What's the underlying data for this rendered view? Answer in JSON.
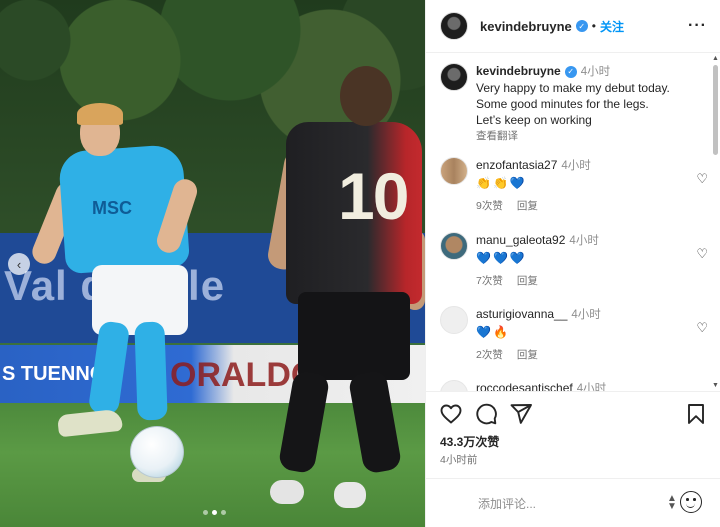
{
  "post": {
    "author": "kevindebruyne",
    "separator": "•",
    "follow_label": "关注",
    "more_label": "···",
    "caption_time": "4小时",
    "caption_text": "Very happy to make my debut today.\nSome good minutes for the legs.\nLet’s keep on working",
    "see_translation": "查看翻译",
    "likes": "43.3万次赞",
    "posted": "4小时前",
    "comment_placeholder": "添加评论..."
  },
  "photo": {
    "banner_text": "Val di Sole",
    "ad_left": "S TUENNO",
    "ad_right": "ORALDO",
    "jersey_sponsor": "MSC",
    "jersey_number": "10",
    "carousel_prev": "‹"
  },
  "comments": [
    {
      "user": "enzofantasia27",
      "time": "4小时",
      "emoji": "👏👏💙",
      "likes": "9次赞",
      "reply": "回复"
    },
    {
      "user": "manu_galeota92",
      "time": "4小时",
      "emoji": "💙💙💙",
      "likes": "7次赞",
      "reply": "回复"
    },
    {
      "user": "asturigiovanna__",
      "time": "4小时",
      "emoji": "💙🔥",
      "likes": "2次赞",
      "reply": "回复"
    },
    {
      "user": "roccodesantischef",
      "time": "4小时"
    }
  ],
  "icons": [
    "verified-badge-icon",
    "heart-icon",
    "comment-icon",
    "share-icon",
    "bookmark-icon",
    "emoji-icon",
    "more-icon"
  ],
  "colors": {
    "accent": "#0095f6",
    "verified": "#3897f0",
    "text": "#262626",
    "muted": "#737373"
  }
}
